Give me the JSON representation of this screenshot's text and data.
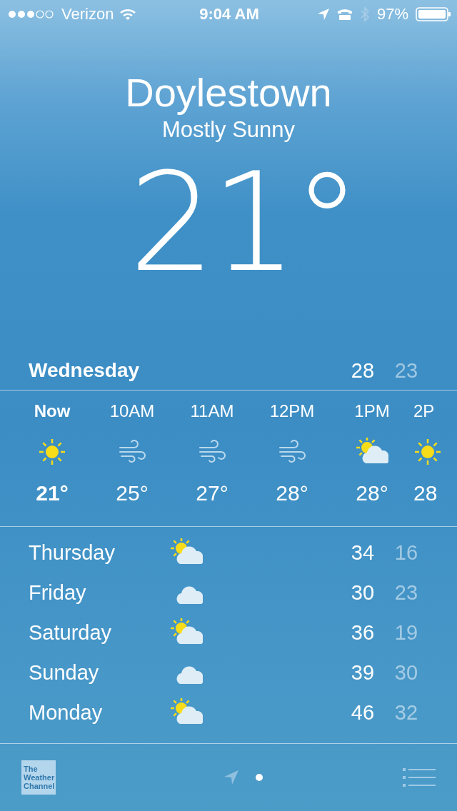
{
  "status_bar": {
    "carrier": "Verizon",
    "time": "9:04 AM",
    "battery": "97%"
  },
  "location": {
    "city": "Doylestown",
    "condition": "Mostly Sunny",
    "temperature": "21°"
  },
  "today": {
    "day": "Wednesday",
    "high": "28",
    "low": "23"
  },
  "hourly": [
    {
      "time": "Now",
      "kind": "sun",
      "temp": "21°",
      "selected": true
    },
    {
      "time": "10AM",
      "kind": "wind",
      "temp": "25°",
      "selected": false
    },
    {
      "time": "11AM",
      "kind": "wind",
      "temp": "27°",
      "selected": false
    },
    {
      "time": "12PM",
      "kind": "wind",
      "temp": "28°",
      "selected": false
    },
    {
      "time": "1PM",
      "kind": "partly",
      "temp": "28°",
      "selected": false
    },
    {
      "time": "2P",
      "kind": "sun",
      "temp": "28",
      "selected": false
    }
  ],
  "daily": [
    {
      "day": "Thursday",
      "kind": "partly",
      "high": "34",
      "low": "16"
    },
    {
      "day": "Friday",
      "kind": "cloud",
      "high": "30",
      "low": "23"
    },
    {
      "day": "Saturday",
      "kind": "partly",
      "high": "36",
      "low": "19"
    },
    {
      "day": "Sunday",
      "kind": "cloud",
      "high": "39",
      "low": "30"
    },
    {
      "day": "Monday",
      "kind": "partly",
      "high": "46",
      "low": "32"
    }
  ],
  "footer": {
    "logo": "The Weather Channel"
  }
}
